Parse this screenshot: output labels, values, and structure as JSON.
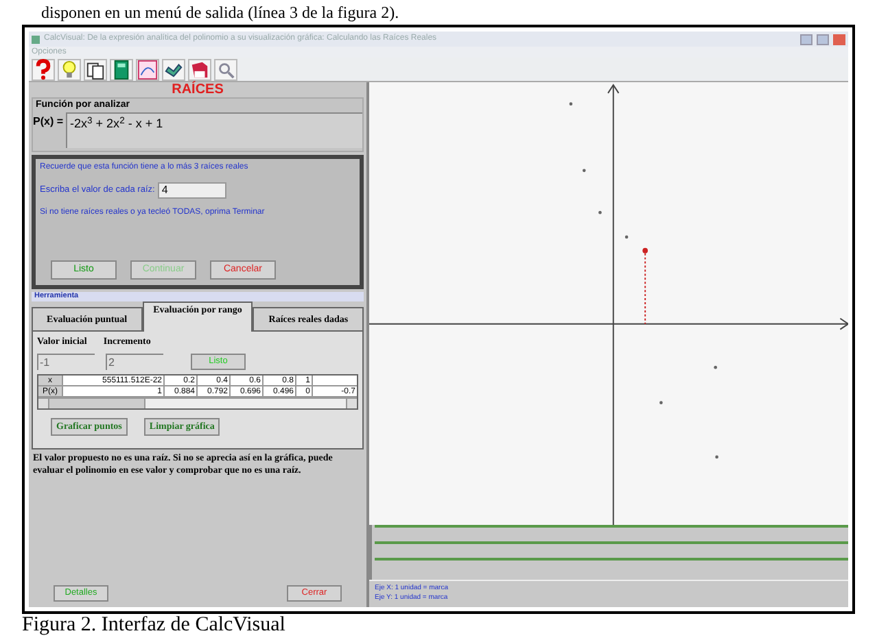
{
  "document_text": "disponen en un menú de salida (línea 3 de la figura 2).",
  "window": {
    "title": "CalcVisual: De la expresión analítica del polinomio a su visualización gráfica: Calculando las Raíces Reales"
  },
  "menu": [
    "Opciones"
  ],
  "panel_title": "RAÍCES",
  "function": {
    "label": "Función por analizar",
    "name": "P(x) =",
    "expression": "-2x$^{3}$ + 2x$^{2}$ - x + 1"
  },
  "dialog": {
    "note": "Recuerde que esta función tiene a lo más 3 raíces reales",
    "prompt": "Escriba el valor de cada raíz:",
    "value": "4",
    "hint": "Si no tiene raíces reales o ya tecleó TODAS, oprima Terminar",
    "buttons": [
      {
        "label": "Listo",
        "color": "#119911"
      },
      {
        "label": "Continuar",
        "color": "#88cc88"
      },
      {
        "label": "Cancelar",
        "color": "#dd2222"
      }
    ]
  },
  "tools_label": "Herramienta",
  "tabs": [
    {
      "label": "Evaluación puntual",
      "selected": false
    },
    {
      "label": "Evaluación por rango",
      "selected": true
    },
    {
      "label": "Raíces reales dadas",
      "selected": false
    }
  ],
  "range": {
    "start_label": "Valor inicial",
    "start": "-1",
    "step_label": "Incremento",
    "step": "2",
    "button": "Listo"
  },
  "table": {
    "rows": [
      {
        "header": "x",
        "cells": [
          "555111.512E-22",
          "0.2",
          "0.4",
          "0.6",
          "0.8",
          "1"
        ]
      },
      {
        "header": "P(x)",
        "cells": [
          "1",
          "0.884",
          "0.792",
          "0.696",
          "0.496",
          "0",
          "-0.7"
        ]
      }
    ]
  },
  "actions": [
    "Graficar puntos",
    "Limpiar gráfica"
  ],
  "message": "El valor propuesto no es una raíz. Si no se aprecia así en la gráfica, puede evaluar el polinomio en ese valor y comprobar que no es una raíz.",
  "footer_buttons": [
    {
      "label": "Detalles",
      "color": "#22aa22"
    },
    {
      "label": "Cerrar",
      "color": "#dd2222"
    }
  ],
  "axis_notes": [
    "Eje X: 1 unidad = marca",
    "Eje Y: 1 unidad = marca"
  ],
  "caption": "Figura 2. Interfaz de CalcVisual"
}
